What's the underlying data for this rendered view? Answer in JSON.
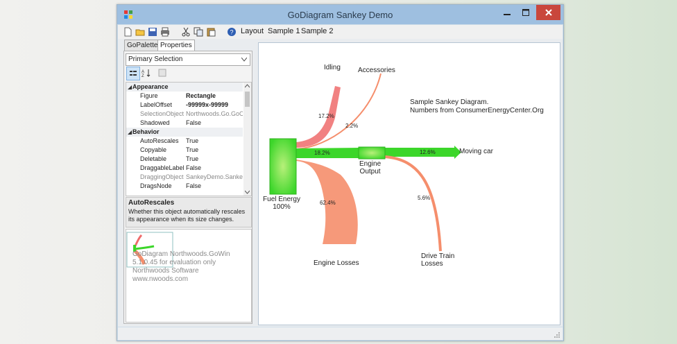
{
  "window": {
    "title": "GoDiagram Sankey Demo"
  },
  "toolbar": {
    "layout_label": "Layout",
    "sample1_label": "Sample 1",
    "sample2_label": "Sample 2"
  },
  "tabs": [
    {
      "label": "GoPalette"
    },
    {
      "label": "Properties",
      "active": true
    }
  ],
  "properties": {
    "selection": "Primary Selection",
    "categories": {
      "appearance": "Appearance",
      "behavior": "Behavior"
    },
    "appearance_rows": [
      {
        "name": "Figure",
        "value": "Rectangle"
      },
      {
        "name": "LabelOffset",
        "value": "-99999x-99999"
      },
      {
        "name": "SelectionObject",
        "value": "Northwoods.Go.GoObject"
      },
      {
        "name": "Shadowed",
        "value": "False"
      }
    ],
    "behavior_rows": [
      {
        "name": "AutoRescales",
        "value": "True"
      },
      {
        "name": "Copyable",
        "value": "True"
      },
      {
        "name": "Deletable",
        "value": "True"
      },
      {
        "name": "DraggableLabel",
        "value": "False"
      },
      {
        "name": "DraggingObject",
        "value": "SankeyDemo.SankeyNode"
      },
      {
        "name": "DragsNode",
        "value": "False"
      }
    ],
    "description_title": "AutoRescales",
    "description_text": "Whether this object automatically rescales its appearance when its size changes."
  },
  "watermark": {
    "line1": "GoDiagram Northwoods.GoWin",
    "line2": "5.1.0.45 for evaluation only",
    "line3": "Northwoods Software",
    "line4": "www.nwoods.com"
  },
  "diagram": {
    "note_line1": "Sample Sankey Diagram.",
    "note_line2": "Numbers from ConsumerEnergyCenter.Org",
    "nodes": {
      "fuel_energy": "Fuel Energy",
      "fuel_pct": "100%",
      "idling": "Idling",
      "accessories": "Accessories",
      "engine_output_1": "Engine",
      "engine_output_2": "Output",
      "moving_car": "Moving car",
      "engine_losses": "Engine Losses",
      "drive_train_1": "Drive Train",
      "drive_train_2": "Losses"
    },
    "links": {
      "idling": "17.2%",
      "accessories": "2.2%",
      "engine_output": "18.2%",
      "moving_car": "12.6%",
      "engine_losses": "62.4%",
      "drive_train": "5.6%"
    },
    "colors": {
      "node": "#3cd62a",
      "losses": "#f58e6c",
      "idling": "#ef6b6b"
    }
  }
}
